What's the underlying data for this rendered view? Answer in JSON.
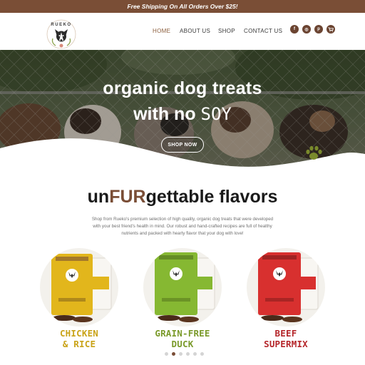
{
  "topbar": {
    "text": "Free Shipping On All Orders Over $25!"
  },
  "logo": {
    "brand": "RUEKO"
  },
  "nav": {
    "home": "HOME",
    "about": "ABOUT US",
    "shop": "SHOP",
    "contact": "CONTACT US"
  },
  "social": [
    {
      "icon": "facebook-icon",
      "glyph": "f"
    },
    {
      "icon": "instagram-icon",
      "glyph": "◎"
    },
    {
      "icon": "pinterest-icon",
      "glyph": "p"
    },
    {
      "icon": "cart-icon",
      "glyph": "🛒"
    }
  ],
  "hero": {
    "line1": "organic dog treats",
    "line2_prefix": "with no ",
    "line2_emphasis": "SOY",
    "button": "SHOP NOW"
  },
  "section": {
    "title_prefix": "un",
    "title_emphasis": "FUR",
    "title_suffix": "gettable flavors",
    "description": "Shop from Rueko's premium selection of high quality, organic dog treats that were developed with your best friend's health in mind. Our robust and hand-crafted recipes are full of healthy nutrients and packed with hearty flavor that your dog with love!"
  },
  "products": [
    {
      "line1": "CHICKEN",
      "line2": "& RICE",
      "color": "#c9a318",
      "bag": "#e2b61c"
    },
    {
      "line1": "GRAIN-FREE",
      "line2": "DUCK",
      "color": "#7a9a2a",
      "bag": "#86b832"
    },
    {
      "line1": "BEEF",
      "line2": "SUPERMIX",
      "color": "#b5262a",
      "bag": "#d8302f"
    }
  ],
  "carousel": {
    "count": 6,
    "active": 2
  },
  "colors": {
    "brand": "#7a4e36",
    "paw": "#7a8a2c"
  }
}
